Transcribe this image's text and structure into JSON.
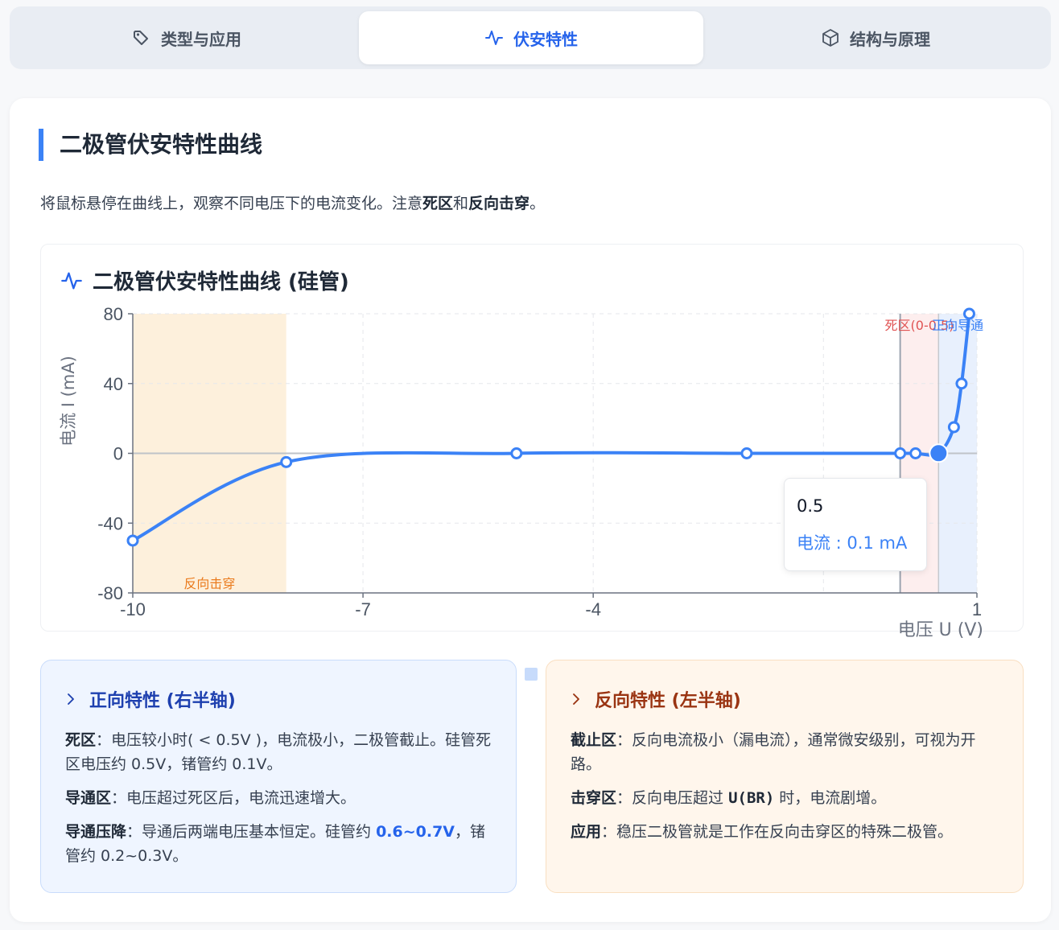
{
  "tabs": [
    {
      "label": "类型与应用",
      "icon": "tag-icon"
    },
    {
      "label": "伏安特性",
      "icon": "activity-icon"
    },
    {
      "label": "结构与原理",
      "icon": "cube-icon"
    }
  ],
  "section": {
    "title": "二极管伏安特性曲线",
    "desc_prefix": "将鼠标悬停在曲线上，观察不同电压下的电流变化。注意",
    "desc_b1": "死区",
    "desc_mid": "和",
    "desc_b2": "反向击穿",
    "desc_suffix": "。"
  },
  "chart_title": "二极管伏安特性曲线 (硅管)",
  "chart_data": {
    "type": "line",
    "title": "二极管伏安特性曲线 (硅管)",
    "xlabel": "电压 U (V)",
    "ylabel": "电流 I (mA)",
    "xlim": [
      -10,
      1
    ],
    "ylim": [
      -80,
      80
    ],
    "x_ticks": [
      -10,
      -7,
      -4,
      1
    ],
    "y_ticks": [
      80,
      40,
      0,
      -40,
      -80
    ],
    "grid": true,
    "series": [
      {
        "color": "#3b82f6",
        "x": [
          -10,
          -8,
          -5,
          -2,
          0,
          0.2,
          0.5,
          0.7,
          0.8,
          0.9
        ],
        "y": [
          -50,
          -5,
          0,
          0,
          0,
          0,
          0.1,
          15,
          40,
          80
        ]
      }
    ],
    "regions": [
      {
        "label": "反向击穿",
        "x": [
          -10,
          -8
        ],
        "color": "#fdf0dc",
        "text_color": "#ea7a1c",
        "label_pos": "bottom"
      },
      {
        "label": "死区(0-0.5)",
        "x": [
          0,
          0.5
        ],
        "color": "#fdeeee",
        "text_color": "#e05353",
        "label_pos": "top"
      },
      {
        "label": "正向导通",
        "x": [
          0.5,
          1
        ],
        "color": "#e8f0fd",
        "text_color": "#3b82f6",
        "label_pos": "top"
      }
    ],
    "active_point": {
      "x": 0.5,
      "y": 0.1
    }
  },
  "tooltip": {
    "x_value": "0.5",
    "y_text": "电流 : 0.1 mA"
  },
  "forward": {
    "title": "正向特性 (右半轴)",
    "p1_label": "死区",
    "p1_text": "：电压较小时( < 0.5V )，电流极小，二极管截止。硅管死区电压约 0.5V，锗管约 0.1V。",
    "p2_label": "导通区",
    "p2_text": "：电压超过死区后，电流迅速增大。",
    "p3_label": "导通压降",
    "p3_text": "：导通后两端电压基本恒定。硅管约 ",
    "p3_hl": "0.6~0.7V",
    "p3_text2": "，锗管约 0.2~0.3V。"
  },
  "reverse": {
    "title": "反向特性 (左半轴)",
    "p1_label": "截止区",
    "p1_text": "：反向电流极小（漏电流），通常微安级别，可视为开路。",
    "p2_label": "击穿区",
    "p2_text": "：反向电压超过 ",
    "p2_code": "U(BR)",
    "p2_text2": " 时，电流剧增。",
    "p3_label": "应用",
    "p3_text": "：稳压二极管就是工作在反向击穿区的特殊二极管。"
  }
}
